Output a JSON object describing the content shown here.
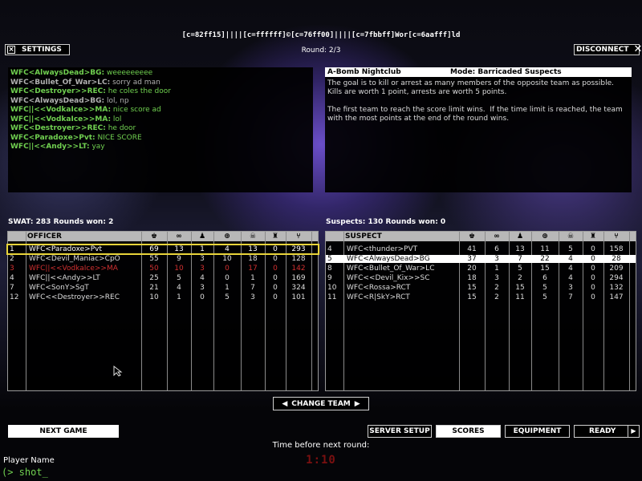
{
  "header": {
    "server_name": "[c=82ff15]||||[c=ffffff]©[c=76ff00]||||[c=7fbbff]Wor[c=6aafff]ld",
    "round": "Round: 2/3"
  },
  "buttons": {
    "settings": "SETTINGS",
    "disconnect": "DISCONNECT",
    "change_team": "CHANGE TEAM",
    "next_game": "NEXT GAME",
    "server_setup": "SERVER SETUP",
    "scores": "SCORES",
    "equipment": "EQUIPMENT",
    "ready": "READY"
  },
  "chat": [
    {
      "name": "WFC<AlwaysDead>BG:",
      "msg": " weeeeeeeee",
      "gray": false
    },
    {
      "name": "WFC<Bullet_Of_War>LC:",
      "msg": " sorry ad man",
      "gray": true
    },
    {
      "name": "WFC<Destroyer>>REC:",
      "msg": " he coles the door",
      "gray": false
    },
    {
      "name": "WFC<AlwaysDead>BG:",
      "msg": " lol, np",
      "gray": true
    },
    {
      "name": "WFC||<<VodkaIce>>MA:",
      "msg": " nice score ad",
      "gray": false
    },
    {
      "name": "WFC||<<VodkaIce>>MA:",
      "msg": " lol",
      "gray": false
    },
    {
      "name": "WFC<Destroyer>>REC:",
      "msg": " he door",
      "gray": false
    },
    {
      "name": "WFC<Paradoxe>Pvt:",
      "msg": " NICE SCORE",
      "gray": false
    },
    {
      "name": "WFC||<<Andy>>LT:",
      "msg": " yay",
      "gray": false
    }
  ],
  "mission": {
    "map": "A-Bomb Nightclub",
    "mode": "Mode: Barricaded Suspects",
    "description": "The goal is to kill or arrest as many members of the opposite team as possible.  Kills are worth 1 point, arrests are worth 5 points.\n\nThe first team to reach the score limit wins.  If the time limit is reached, the team with the most points at the end of the round wins."
  },
  "swat": {
    "summary": "SWAT: 283   Rounds won: 2",
    "header": "OFFICER",
    "rows": [
      {
        "num": "1",
        "name": "WFC<Paradoxe>Pvt",
        "s": [
          "69",
          "13",
          "1",
          "4",
          "13",
          "0",
          "293"
        ],
        "style": "hl"
      },
      {
        "num": "2",
        "name": "WFC<Devil_Maniac>CpO",
        "s": [
          "55",
          "9",
          "3",
          "10",
          "18",
          "0",
          "128"
        ],
        "style": ""
      },
      {
        "num": "3",
        "name": "WFC||<<VodkaIce>>MA",
        "s": [
          "50",
          "10",
          "3",
          "0",
          "17",
          "0",
          "142"
        ],
        "style": "red"
      },
      {
        "num": "4",
        "name": "WFC||<<Andy>>LT",
        "s": [
          "25",
          "5",
          "4",
          "0",
          "1",
          "0",
          "169"
        ],
        "style": ""
      },
      {
        "num": "7",
        "name": "WFC<SonY>SgT",
        "s": [
          "21",
          "4",
          "3",
          "1",
          "7",
          "0",
          "324"
        ],
        "style": ""
      },
      {
        "num": "12",
        "name": "WFC<<Destroyer>>REC",
        "s": [
          "10",
          "1",
          "0",
          "5",
          "3",
          "0",
          "101"
        ],
        "style": ""
      }
    ]
  },
  "suspects": {
    "summary": "Suspects: 130   Rounds won: 0",
    "header": "SUSPECT",
    "rows": [
      {
        "num": "4",
        "name": "WFC<thunder>PVT",
        "s": [
          "41",
          "6",
          "13",
          "11",
          "5",
          "0",
          "158"
        ],
        "style": ""
      },
      {
        "num": "5",
        "name": "WFC<AlwaysDead>BG",
        "s": [
          "37",
          "3",
          "7",
          "22",
          "4",
          "0",
          "28"
        ],
        "style": "sel"
      },
      {
        "num": "8",
        "name": "WFC<Bullet_Of_War>LC",
        "s": [
          "20",
          "1",
          "5",
          "15",
          "4",
          "0",
          "209"
        ],
        "style": ""
      },
      {
        "num": "9",
        "name": "WFC<<Devil_Kix>>SC",
        "s": [
          "18",
          "3",
          "2",
          "6",
          "4",
          "0",
          "294"
        ],
        "style": ""
      },
      {
        "num": "10",
        "name": "WFC<Rossa>RCT",
        "s": [
          "15",
          "2",
          "15",
          "5",
          "3",
          "0",
          "132"
        ],
        "style": ""
      },
      {
        "num": "11",
        "name": "WFC<R|SkY>RCT",
        "s": [
          "15",
          "2",
          "11",
          "5",
          "7",
          "0",
          "147"
        ],
        "style": ""
      }
    ]
  },
  "footer": {
    "time_label": "Time before next round:",
    "timer": "1:10",
    "player_name_label": "Player Name",
    "console": "(> shot_"
  },
  "colors": {
    "chat_green": "#70d050",
    "highlight_yellow": "#e8d43a",
    "dead_red": "#d03030"
  }
}
